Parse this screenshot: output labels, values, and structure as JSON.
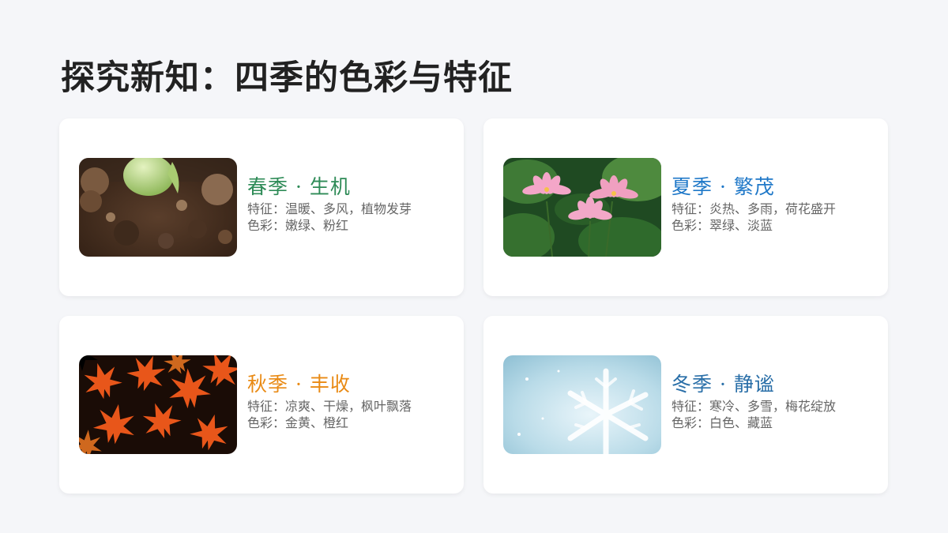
{
  "page": {
    "title": "探究新知：四季的色彩与特征"
  },
  "cards": [
    {
      "season": "春季 · 生机",
      "traits": "特征：温暖、多风，植物发芽",
      "colors": "色彩：嫩绿、粉红",
      "accent": "#2e8b57",
      "image": "sprout-in-soil"
    },
    {
      "season": "夏季 · 繁茂",
      "traits": "特征：炎热、多雨，荷花盛开",
      "colors": "色彩：翠绿、淡蓝",
      "accent": "#1f78c8",
      "image": "lotus-flowers"
    },
    {
      "season": "秋季 · 丰收",
      "traits": "特征：凉爽、干燥，枫叶飘落",
      "colors": "色彩：金黄、橙红",
      "accent": "#e98a14",
      "image": "maple-leaves"
    },
    {
      "season": "冬季 · 静谧",
      "traits": "特征：寒冷、多雪，梅花绽放",
      "colors": "色彩：白色、藏蓝",
      "accent": "#2a6fa8",
      "image": "snowflake"
    }
  ]
}
